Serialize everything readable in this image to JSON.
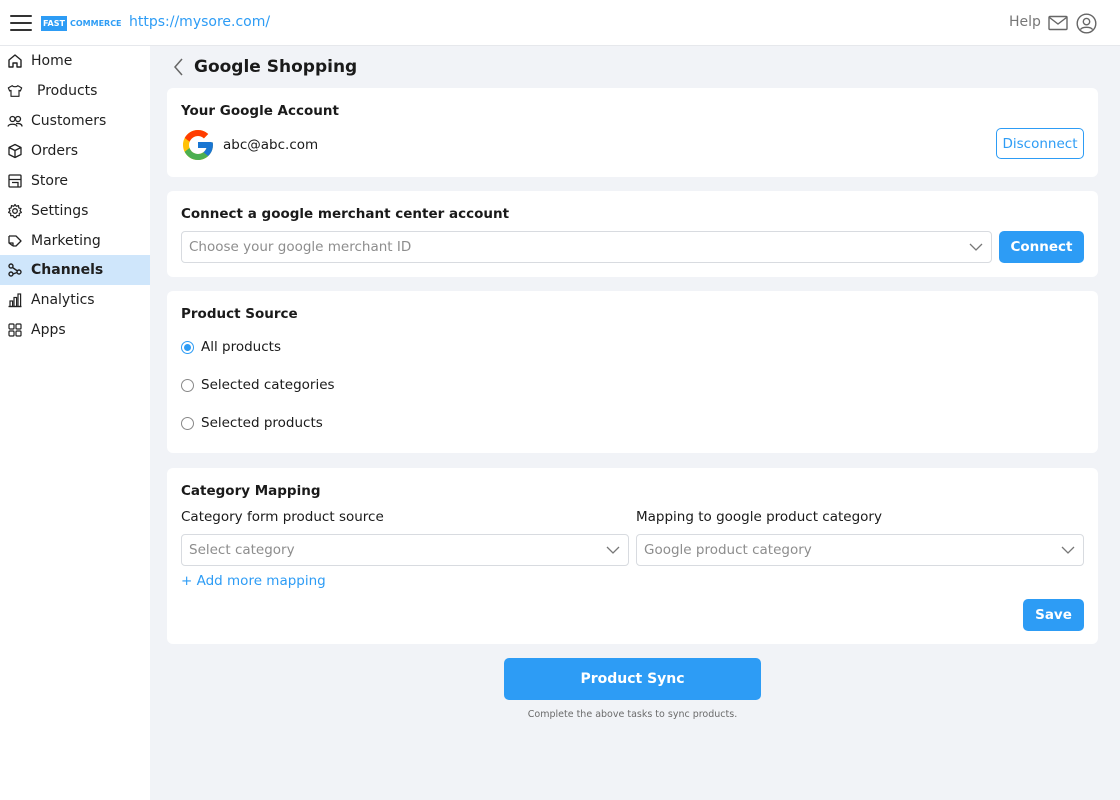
{
  "topbar": {
    "logo_fast": "FAST",
    "logo_commerce": "COMMERCE",
    "site_url": "https://mysore.com/",
    "help_label": "Help"
  },
  "sidebar": {
    "items": [
      {
        "label": "Home",
        "icon": "home-icon"
      },
      {
        "label": "Products",
        "icon": "shirt-icon"
      },
      {
        "label": "Customers",
        "icon": "users-icon"
      },
      {
        "label": "Orders",
        "icon": "box-icon"
      },
      {
        "label": "Store",
        "icon": "store-icon"
      },
      {
        "label": "Settings",
        "icon": "gear-icon"
      },
      {
        "label": "Marketing",
        "icon": "megaphone-icon"
      },
      {
        "label": "Channels",
        "icon": "channels-icon",
        "active": true
      },
      {
        "label": "Analytics",
        "icon": "analytics-icon"
      },
      {
        "label": "Apps",
        "icon": "apps-icon"
      }
    ]
  },
  "page": {
    "title": "Google Shopping"
  },
  "account_card": {
    "title": "Your Google Account",
    "email": "abc@abc.com",
    "disconnect_label": "Disconnect"
  },
  "merchant_card": {
    "title": "Connect a google merchant center account",
    "select_placeholder": "Choose your google merchant ID",
    "connect_label": "Connect"
  },
  "source_card": {
    "title": "Product Source",
    "options": [
      {
        "label": "All products",
        "checked": true
      },
      {
        "label": "Selected categories",
        "checked": false
      },
      {
        "label": "Selected products",
        "checked": false
      }
    ]
  },
  "mapping_card": {
    "title": "Category Mapping",
    "left_label": "Category form product source",
    "right_label": "Mapping to google product category",
    "left_placeholder": "Select category",
    "right_placeholder": "Google product category",
    "add_more_label": "+ Add more mapping",
    "save_label": "Save"
  },
  "sync": {
    "button_label": "Product Sync",
    "hint": "Complete the above tasks to sync products."
  },
  "colors": {
    "accent": "#2d9cf5",
    "active_nav_bg": "#cfe6fb",
    "page_bg": "#f1f3f7"
  }
}
